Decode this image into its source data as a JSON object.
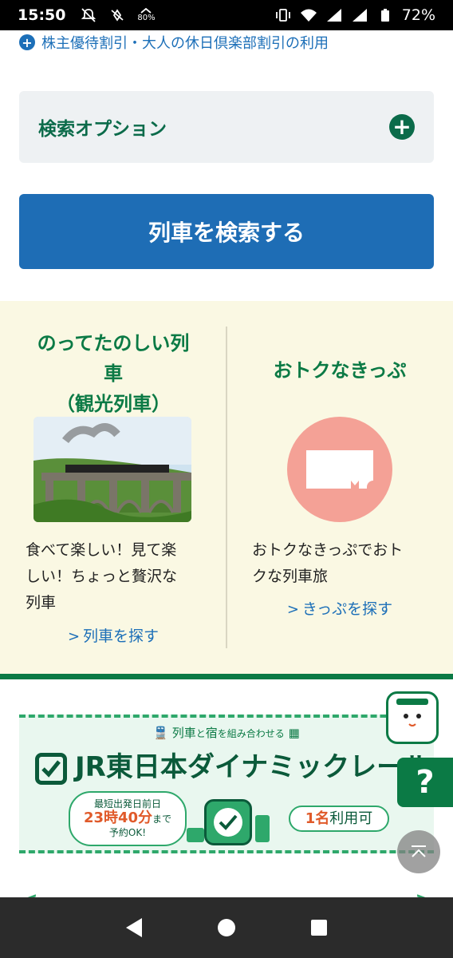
{
  "status_bar": {
    "time": "15:50",
    "battery_pct": "72%",
    "data_saver_pct": "80%"
  },
  "discount_link": "株主優待割引・大人の休日倶楽部割引の利用",
  "search_options": {
    "label": "検索オプション"
  },
  "search_button": "列車を検索する",
  "features": {
    "left": {
      "title": "のってたのしい列車（観光列車）",
      "title_line1": "のってたのしい列",
      "title_line2": "車",
      "title_line3": "（観光列車）",
      "description": "食べて楽しい！見て楽しい！ちょっと贅沢な列車",
      "desc_line1": "食べて楽しい！見て楽",
      "desc_line2": "しい！ちょっと贅沢な",
      "desc_line3": "列車",
      "link": "列車を探す"
    },
    "right": {
      "title": "おトクなきっぷ",
      "description": "おトクなきっぷでおトクな列車旅",
      "desc_line1": "おトクなきっぷでおト",
      "desc_line2": "クな列車旅",
      "link": "きっぷを探す"
    }
  },
  "banner": {
    "subtitle_part1": "列車",
    "subtitle_part2": "と",
    "subtitle_part3": "宿",
    "subtitle_part4": "を組み合わせる",
    "title": "JR東日本ダイナミックレールパッ",
    "bubble_left_line1": "最短出発日前日",
    "bubble_left_time": "23時40分",
    "bubble_left_suffix": "まで",
    "bubble_left_line3": "予約OK!",
    "bubble_right_num": "1名",
    "bubble_right_text": "利用可"
  },
  "carousel": {
    "prev": "<",
    "next": ">",
    "slide_count": 2,
    "active_index": 0
  },
  "help_button": "?",
  "colors": {
    "brand_green": "#0b7a45",
    "link_blue": "#1c6fb8",
    "button_blue": "#1e6db5",
    "feature_bg": "#faf8e3",
    "ticket_pink": "#f4a196"
  }
}
